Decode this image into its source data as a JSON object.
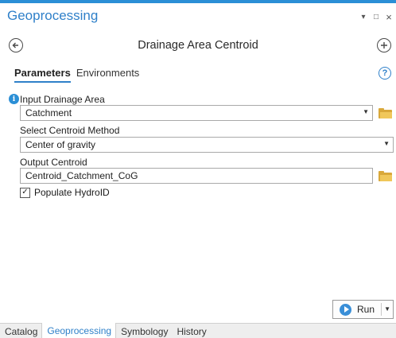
{
  "pane": {
    "title": "Geoprocessing",
    "controls": {
      "pin": "▾",
      "maximize": "□",
      "close": "×"
    }
  },
  "tool": {
    "title": "Drainage Area Centroid",
    "back_icon": "back-arrow-icon",
    "add_icon": "add-icon"
  },
  "tabs": [
    {
      "label": "Parameters",
      "active": true
    },
    {
      "label": "Environments",
      "active": false
    }
  ],
  "help_icon": "?",
  "info_icon": "i",
  "parameters": {
    "input_drainage_area": {
      "label": "Input Drainage Area",
      "value": "Catchment"
    },
    "centroid_method": {
      "label": "Select Centroid Method",
      "value": "Center of gravity"
    },
    "output_centroid": {
      "label": "Output Centroid",
      "value": "Centroid_Catchment_CoG"
    },
    "populate_hydroid": {
      "label": "Populate HydroID",
      "checked": true,
      "mark": "✓"
    }
  },
  "run_button": {
    "label": "Run"
  },
  "dropdown_caret": "▼",
  "bottom_tabs": [
    {
      "label": "Catalog",
      "active": false
    },
    {
      "label": "Geoprocessing",
      "active": true
    },
    {
      "label": "Symbology",
      "active": false
    },
    {
      "label": "History",
      "active": false
    }
  ],
  "colors": {
    "accent": "#2f80c9",
    "folder": "#f0c75a",
    "run": "#3a8fd8"
  }
}
